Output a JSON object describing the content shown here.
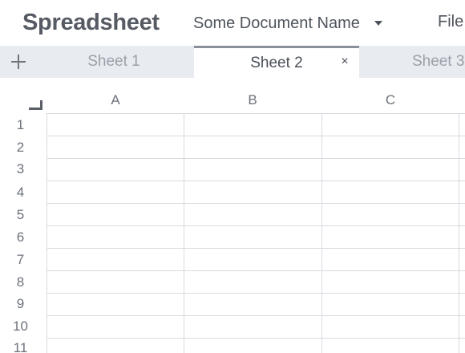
{
  "app": {
    "title": "Spreadsheet"
  },
  "document": {
    "name": "Some Document Name"
  },
  "menu": {
    "file": "File"
  },
  "tabs": [
    {
      "label": "Sheet 1",
      "active": false
    },
    {
      "label": "Sheet 2",
      "active": true,
      "close": "×"
    },
    {
      "label": "Sheet 3",
      "active": false
    }
  ],
  "grid": {
    "columns": [
      "A",
      "B",
      "C"
    ],
    "rows": [
      "1",
      "2",
      "3",
      "4",
      "5",
      "6",
      "7",
      "8",
      "9",
      "10",
      "11"
    ]
  },
  "colors": {
    "tab_bar": "#e8ebf0",
    "grid_line": "#d7dadf",
    "text": "#4a4f57"
  }
}
